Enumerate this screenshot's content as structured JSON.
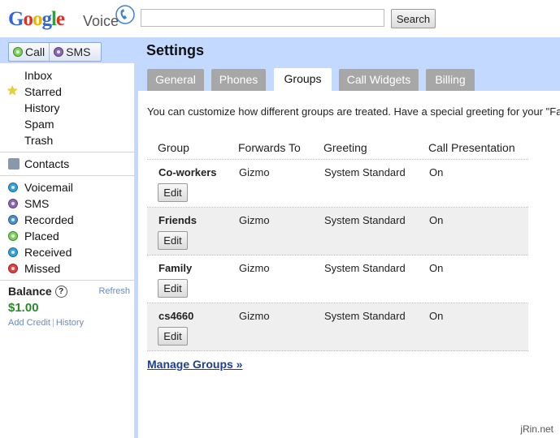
{
  "header": {
    "logo_google": "Google",
    "logo_voice": "Voice",
    "search_value": "",
    "search_button": "Search"
  },
  "leftbar": {
    "call_label": "Call",
    "sms_label": "SMS",
    "folders": [
      "Inbox",
      "Starred",
      "History",
      "Spam",
      "Trash"
    ],
    "contacts_label": "Contacts",
    "types": [
      {
        "label": "Voicemail",
        "icon": "voicemail-icon",
        "color": "#3aa0d8"
      },
      {
        "label": "SMS",
        "icon": "sms-icon",
        "color": "#8a6ab0"
      },
      {
        "label": "Recorded",
        "icon": "recorded-icon",
        "color": "#4a90d0"
      },
      {
        "label": "Placed",
        "icon": "placed-icon",
        "color": "#7ed35f"
      },
      {
        "label": "Received",
        "icon": "received-icon",
        "color": "#3aa0d8"
      },
      {
        "label": "Missed",
        "icon": "missed-icon",
        "color": "#dd4444"
      }
    ],
    "balance": {
      "title": "Balance",
      "help": "?",
      "refresh": "Refresh",
      "amount": "$1.00",
      "add_credit": "Add Credit",
      "history": "History"
    }
  },
  "main": {
    "title": "Settings",
    "tabs": [
      {
        "label": "General",
        "active": false
      },
      {
        "label": "Phones",
        "active": false
      },
      {
        "label": "Groups",
        "active": true
      },
      {
        "label": "Call Widgets",
        "active": false
      },
      {
        "label": "Billing",
        "active": false
      }
    ],
    "intro": "You can customize how different groups are treated. Have a special greeting for your \"Fa",
    "columns": [
      "Group",
      "Forwards To",
      "Greeting",
      "Call Presentation"
    ],
    "groups": [
      {
        "name": "Co-workers",
        "forwards_to": "Gizmo",
        "greeting": "System Standard",
        "call_presentation": "On",
        "edit": "Edit"
      },
      {
        "name": "Friends",
        "forwards_to": "Gizmo",
        "greeting": "System Standard",
        "call_presentation": "On",
        "edit": "Edit"
      },
      {
        "name": "Family",
        "forwards_to": "Gizmo",
        "greeting": "System Standard",
        "call_presentation": "On",
        "edit": "Edit"
      },
      {
        "name": "cs4660",
        "forwards_to": "Gizmo",
        "greeting": "System Standard",
        "call_presentation": "On",
        "edit": "Edit"
      }
    ],
    "manage_link": "Manage Groups »"
  },
  "watermark": "jRin.net",
  "colors": {
    "accent_bg": "#c3d9ff",
    "tab_inactive": "#a7a7a7",
    "link": "#1d3f8f",
    "balance_amount": "#2a8a2a"
  }
}
